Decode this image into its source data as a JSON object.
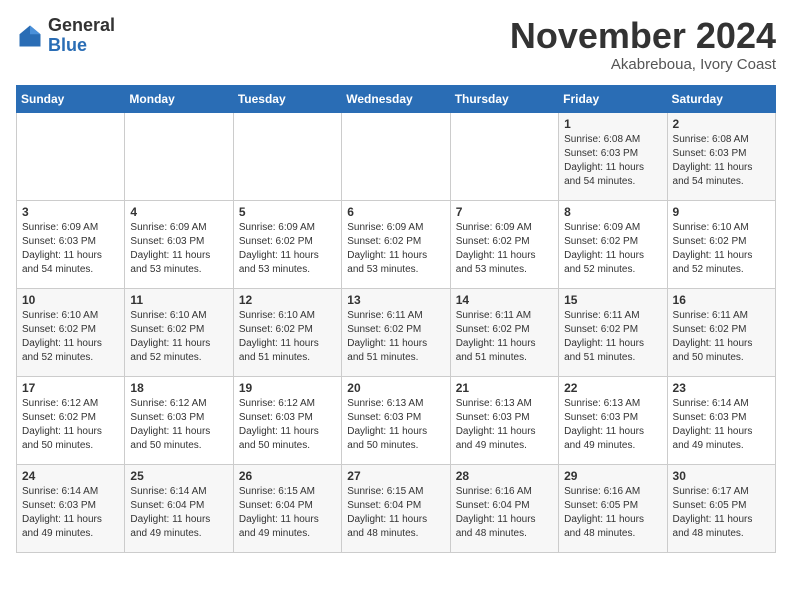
{
  "header": {
    "logo_general": "General",
    "logo_blue": "Blue",
    "month": "November 2024",
    "location": "Akabreboua, Ivory Coast"
  },
  "weekdays": [
    "Sunday",
    "Monday",
    "Tuesday",
    "Wednesday",
    "Thursday",
    "Friday",
    "Saturday"
  ],
  "weeks": [
    [
      {
        "day": "",
        "sunrise": "",
        "sunset": "",
        "daylight": ""
      },
      {
        "day": "",
        "sunrise": "",
        "sunset": "",
        "daylight": ""
      },
      {
        "day": "",
        "sunrise": "",
        "sunset": "",
        "daylight": ""
      },
      {
        "day": "",
        "sunrise": "",
        "sunset": "",
        "daylight": ""
      },
      {
        "day": "",
        "sunrise": "",
        "sunset": "",
        "daylight": ""
      },
      {
        "day": "1",
        "sunrise": "Sunrise: 6:08 AM",
        "sunset": "Sunset: 6:03 PM",
        "daylight": "Daylight: 11 hours and 54 minutes."
      },
      {
        "day": "2",
        "sunrise": "Sunrise: 6:08 AM",
        "sunset": "Sunset: 6:03 PM",
        "daylight": "Daylight: 11 hours and 54 minutes."
      }
    ],
    [
      {
        "day": "3",
        "sunrise": "Sunrise: 6:09 AM",
        "sunset": "Sunset: 6:03 PM",
        "daylight": "Daylight: 11 hours and 54 minutes."
      },
      {
        "day": "4",
        "sunrise": "Sunrise: 6:09 AM",
        "sunset": "Sunset: 6:03 PM",
        "daylight": "Daylight: 11 hours and 53 minutes."
      },
      {
        "day": "5",
        "sunrise": "Sunrise: 6:09 AM",
        "sunset": "Sunset: 6:02 PM",
        "daylight": "Daylight: 11 hours and 53 minutes."
      },
      {
        "day": "6",
        "sunrise": "Sunrise: 6:09 AM",
        "sunset": "Sunset: 6:02 PM",
        "daylight": "Daylight: 11 hours and 53 minutes."
      },
      {
        "day": "7",
        "sunrise": "Sunrise: 6:09 AM",
        "sunset": "Sunset: 6:02 PM",
        "daylight": "Daylight: 11 hours and 53 minutes."
      },
      {
        "day": "8",
        "sunrise": "Sunrise: 6:09 AM",
        "sunset": "Sunset: 6:02 PM",
        "daylight": "Daylight: 11 hours and 52 minutes."
      },
      {
        "day": "9",
        "sunrise": "Sunrise: 6:10 AM",
        "sunset": "Sunset: 6:02 PM",
        "daylight": "Daylight: 11 hours and 52 minutes."
      }
    ],
    [
      {
        "day": "10",
        "sunrise": "Sunrise: 6:10 AM",
        "sunset": "Sunset: 6:02 PM",
        "daylight": "Daylight: 11 hours and 52 minutes."
      },
      {
        "day": "11",
        "sunrise": "Sunrise: 6:10 AM",
        "sunset": "Sunset: 6:02 PM",
        "daylight": "Daylight: 11 hours and 52 minutes."
      },
      {
        "day": "12",
        "sunrise": "Sunrise: 6:10 AM",
        "sunset": "Sunset: 6:02 PM",
        "daylight": "Daylight: 11 hours and 51 minutes."
      },
      {
        "day": "13",
        "sunrise": "Sunrise: 6:11 AM",
        "sunset": "Sunset: 6:02 PM",
        "daylight": "Daylight: 11 hours and 51 minutes."
      },
      {
        "day": "14",
        "sunrise": "Sunrise: 6:11 AM",
        "sunset": "Sunset: 6:02 PM",
        "daylight": "Daylight: 11 hours and 51 minutes."
      },
      {
        "day": "15",
        "sunrise": "Sunrise: 6:11 AM",
        "sunset": "Sunset: 6:02 PM",
        "daylight": "Daylight: 11 hours and 51 minutes."
      },
      {
        "day": "16",
        "sunrise": "Sunrise: 6:11 AM",
        "sunset": "Sunset: 6:02 PM",
        "daylight": "Daylight: 11 hours and 50 minutes."
      }
    ],
    [
      {
        "day": "17",
        "sunrise": "Sunrise: 6:12 AM",
        "sunset": "Sunset: 6:02 PM",
        "daylight": "Daylight: 11 hours and 50 minutes."
      },
      {
        "day": "18",
        "sunrise": "Sunrise: 6:12 AM",
        "sunset": "Sunset: 6:03 PM",
        "daylight": "Daylight: 11 hours and 50 minutes."
      },
      {
        "day": "19",
        "sunrise": "Sunrise: 6:12 AM",
        "sunset": "Sunset: 6:03 PM",
        "daylight": "Daylight: 11 hours and 50 minutes."
      },
      {
        "day": "20",
        "sunrise": "Sunrise: 6:13 AM",
        "sunset": "Sunset: 6:03 PM",
        "daylight": "Daylight: 11 hours and 50 minutes."
      },
      {
        "day": "21",
        "sunrise": "Sunrise: 6:13 AM",
        "sunset": "Sunset: 6:03 PM",
        "daylight": "Daylight: 11 hours and 49 minutes."
      },
      {
        "day": "22",
        "sunrise": "Sunrise: 6:13 AM",
        "sunset": "Sunset: 6:03 PM",
        "daylight": "Daylight: 11 hours and 49 minutes."
      },
      {
        "day": "23",
        "sunrise": "Sunrise: 6:14 AM",
        "sunset": "Sunset: 6:03 PM",
        "daylight": "Daylight: 11 hours and 49 minutes."
      }
    ],
    [
      {
        "day": "24",
        "sunrise": "Sunrise: 6:14 AM",
        "sunset": "Sunset: 6:03 PM",
        "daylight": "Daylight: 11 hours and 49 minutes."
      },
      {
        "day": "25",
        "sunrise": "Sunrise: 6:14 AM",
        "sunset": "Sunset: 6:04 PM",
        "daylight": "Daylight: 11 hours and 49 minutes."
      },
      {
        "day": "26",
        "sunrise": "Sunrise: 6:15 AM",
        "sunset": "Sunset: 6:04 PM",
        "daylight": "Daylight: 11 hours and 49 minutes."
      },
      {
        "day": "27",
        "sunrise": "Sunrise: 6:15 AM",
        "sunset": "Sunset: 6:04 PM",
        "daylight": "Daylight: 11 hours and 48 minutes."
      },
      {
        "day": "28",
        "sunrise": "Sunrise: 6:16 AM",
        "sunset": "Sunset: 6:04 PM",
        "daylight": "Daylight: 11 hours and 48 minutes."
      },
      {
        "day": "29",
        "sunrise": "Sunrise: 6:16 AM",
        "sunset": "Sunset: 6:05 PM",
        "daylight": "Daylight: 11 hours and 48 minutes."
      },
      {
        "day": "30",
        "sunrise": "Sunrise: 6:17 AM",
        "sunset": "Sunset: 6:05 PM",
        "daylight": "Daylight: 11 hours and 48 minutes."
      }
    ]
  ]
}
